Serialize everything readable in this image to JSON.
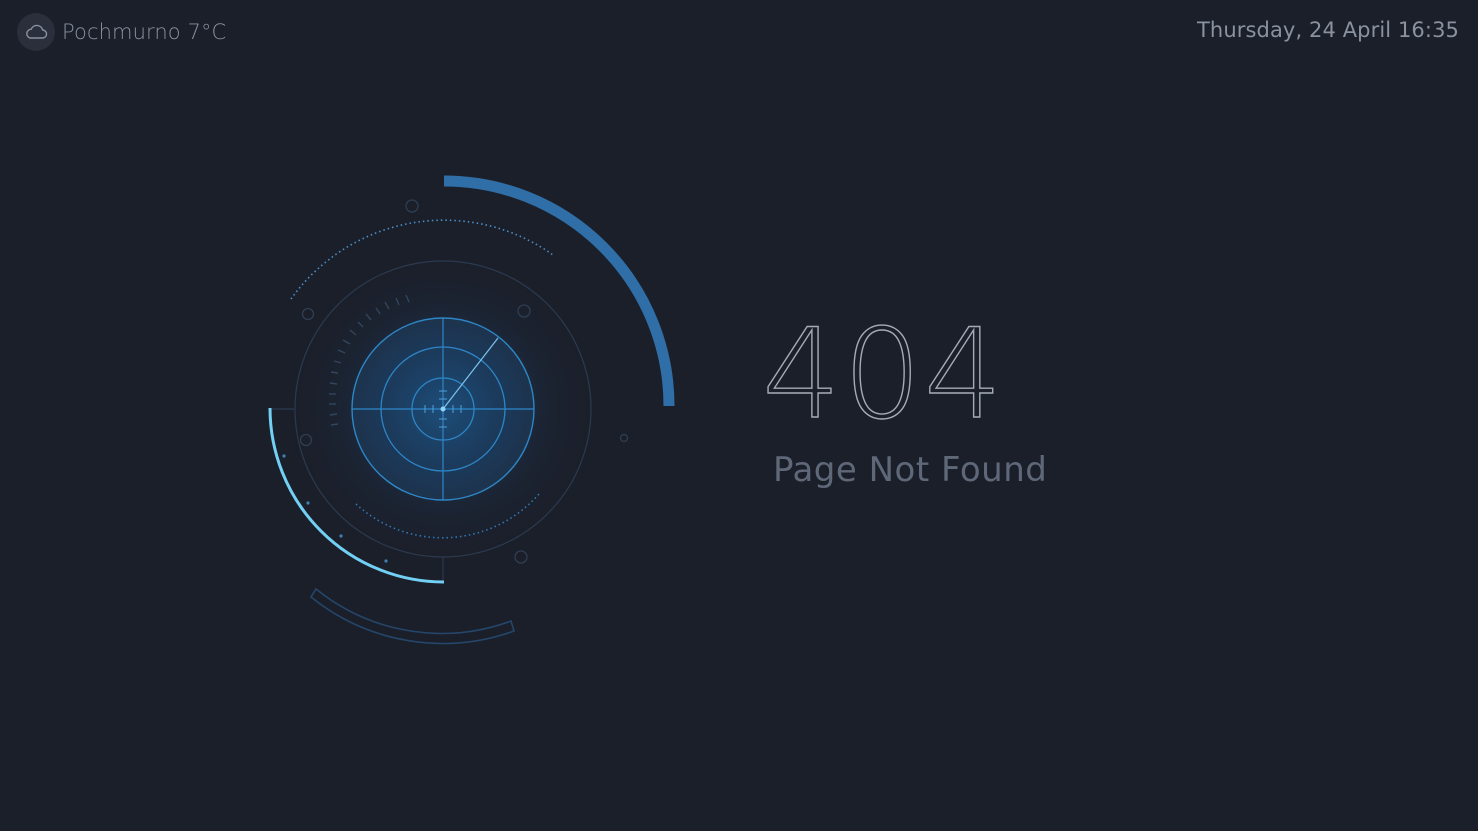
{
  "weather": {
    "icon": "cloud-icon",
    "text": "Pochmurno 7°C"
  },
  "datetime": "Thursday, 24 April 16:35",
  "error": {
    "code": "404",
    "message": "Page Not Found"
  },
  "colors": {
    "background": "#1b1f2a",
    "accent_dark_blue": "#2e6da4",
    "accent_light_blue": "#6fd0f5",
    "text_muted": "#8a919f"
  }
}
